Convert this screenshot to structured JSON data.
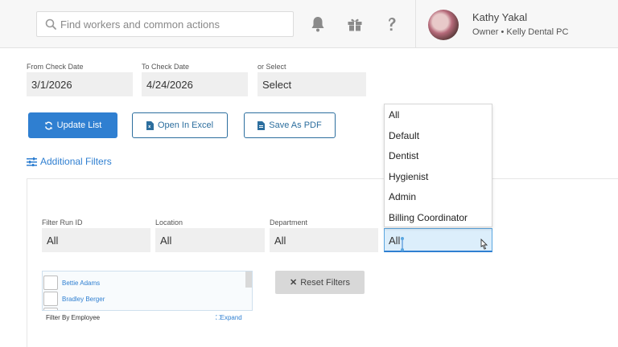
{
  "search": {
    "placeholder": "Find workers and common actions"
  },
  "header": {
    "icons": [
      "bell-icon",
      "gift-icon",
      "help-icon"
    ],
    "user_name": "Kathy Yakal",
    "user_role": "Owner • Kelly Dental PC"
  },
  "filters": {
    "from_label": "From Check Date",
    "from_value": "3/1/2026",
    "to_label": "To Check Date",
    "to_value": "4/24/2026",
    "or_label": "or Select",
    "or_value": "Select"
  },
  "buttons": {
    "update": "Update List",
    "excel": "Open In Excel",
    "pdf": "Save As PDF",
    "additional": "Additional Filters",
    "reset": "Reset Filters"
  },
  "additional_filters": {
    "run_id_label": "Filter Run ID",
    "run_id_value": "All",
    "location_label": "Location",
    "location_value": "All",
    "department_label": "Department",
    "department_value": "All",
    "position_value": "All"
  },
  "dropdown": {
    "options": [
      "All",
      "Default",
      "Dentist",
      "Hygienist",
      "Admin",
      "Billing Coordinator"
    ]
  },
  "employees": {
    "items": [
      "Bettie Adams",
      "Bradley Berger"
    ],
    "footer_label": "Filter By Employee",
    "expand_label": "Expand"
  },
  "colors": {
    "accent": "#2f7fd1",
    "outline": "#2c6e9e"
  }
}
